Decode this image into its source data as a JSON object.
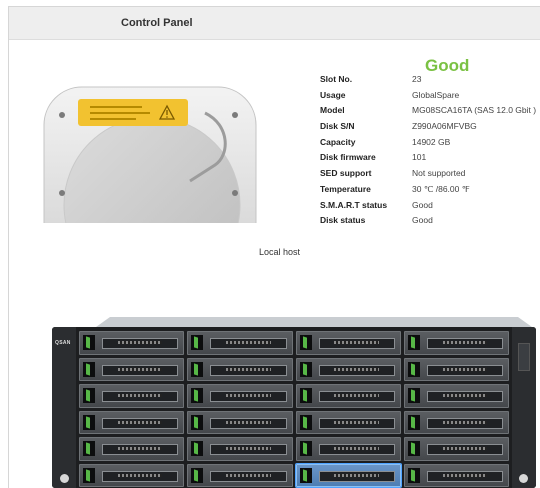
{
  "window": {
    "title": "Control Panel"
  },
  "disk": {
    "status_heading": "Good",
    "details": [
      {
        "label": "Slot No.",
        "value": "23"
      },
      {
        "label": "Usage",
        "value": "GlobalSpare"
      },
      {
        "label": "Model",
        "value": "MG08SCA16TA (SAS 12.0 Gbit )"
      },
      {
        "label": "Disk S/N",
        "value": "Z990A06MFVBG"
      },
      {
        "label": "Capacity",
        "value": "14902 GB"
      },
      {
        "label": "Disk firmware",
        "value": "101"
      },
      {
        "label": "SED support",
        "value": "Not supported"
      },
      {
        "label": "Temperature",
        "value": "30 ℃ /86.00 ℉"
      },
      {
        "label": "S.M.A.R.T status",
        "value": "Good"
      },
      {
        "label": "Disk status",
        "value": "Good"
      }
    ],
    "status_color": "#7ac143",
    "warning_icon": "warning-triangle-icon"
  },
  "enclosure": {
    "host_label": "Local host",
    "brand": "QSAN",
    "columns": 4,
    "rows": 6,
    "selected_slot_index": 22,
    "selection_color": "#4fa3ff",
    "latch_color": "#57b847"
  }
}
